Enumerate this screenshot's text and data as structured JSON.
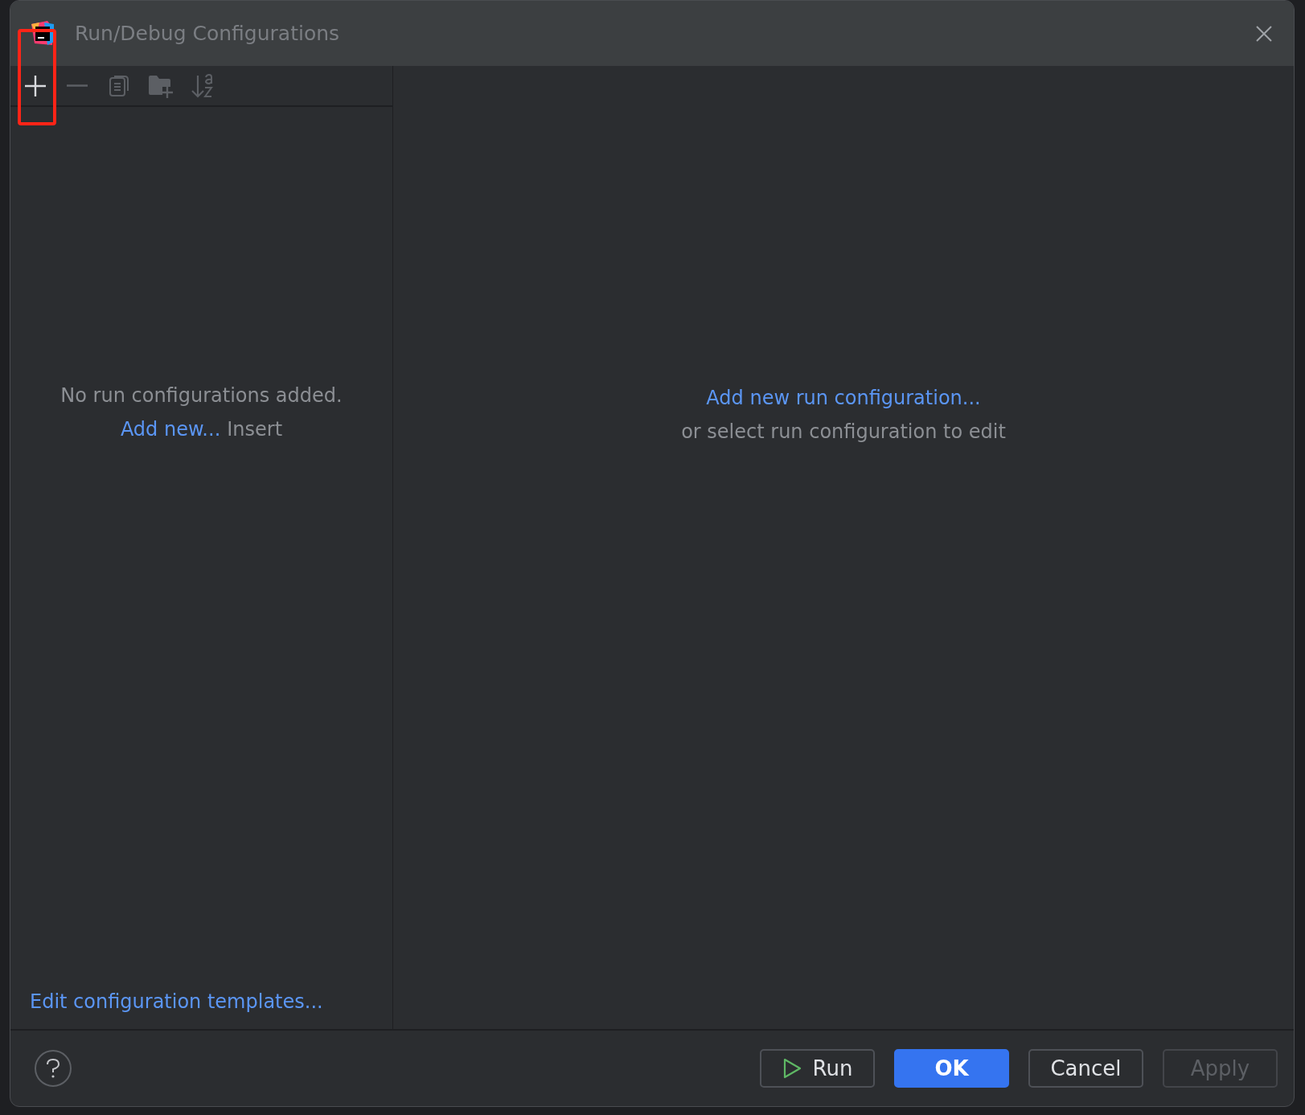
{
  "window": {
    "title": "Run/Debug Configurations"
  },
  "toolbar": [
    {
      "kind": "add",
      "disabled": false,
      "highlighted": true
    },
    {
      "kind": "remove",
      "disabled": true,
      "highlighted": false
    },
    {
      "kind": "copy",
      "disabled": true,
      "highlighted": false
    },
    {
      "kind": "folder",
      "disabled": true,
      "highlighted": false
    },
    {
      "kind": "sort",
      "disabled": true,
      "highlighted": false
    }
  ],
  "left_panel": {
    "empty_text": "No run configurations added.",
    "add_link": "Add new...",
    "shortcut": "Insert",
    "templates_link": "Edit configuration templates..."
  },
  "right_panel": {
    "add_link": "Add new run configuration...",
    "hint": "or select run configuration to edit"
  },
  "buttons": [
    {
      "label": "Run",
      "kind": "run",
      "disabled": false
    },
    {
      "label": "OK",
      "kind": "primary",
      "disabled": false
    },
    {
      "label": "Cancel",
      "kind": "normal",
      "disabled": false
    },
    {
      "label": "Apply",
      "kind": "normal",
      "disabled": true
    }
  ]
}
